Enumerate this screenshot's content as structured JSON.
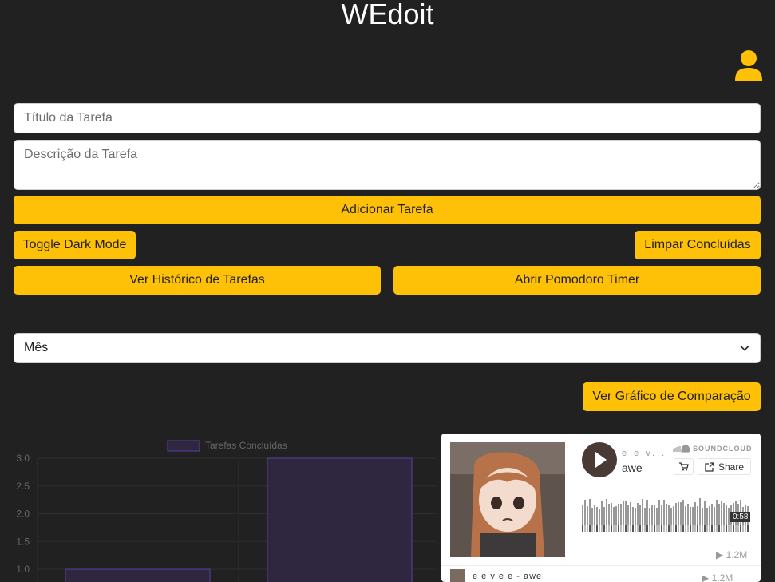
{
  "app": {
    "title": "WEdoit"
  },
  "form": {
    "title_placeholder": "Título da Tarefa",
    "description_placeholder": "Descrição da Tarefa",
    "add_label": "Adicionar Tarefa"
  },
  "controls": {
    "dark_mode_label": "Toggle Dark Mode",
    "clear_completed_label": "Limpar Concluídas",
    "history_label": "Ver Histórico de Tarefas",
    "pomodoro_label": "Abrir Pomodoro Timer"
  },
  "period_select": {
    "selected": "Mês"
  },
  "compare_label": "Ver Gráfico de Comparação",
  "colors": {
    "accent": "#ffc107",
    "background": "#212121",
    "bar_fill": "#2f2640",
    "bar_border": "#5c3fa0"
  },
  "chart_data": {
    "type": "bar",
    "legend": [
      "Tarefas Concluídas"
    ],
    "y_ticks": [
      "3.0",
      "2.5",
      "2.0",
      "1.5",
      "1.0"
    ],
    "ylim": [
      1.0,
      3.0
    ],
    "series": [
      {
        "name": "Tarefas Concluídas",
        "values": [
          1,
          3
        ]
      }
    ]
  },
  "soundcloud": {
    "user": "e e v...",
    "track": "awe",
    "brand": "SOUNDCLOUD",
    "share_label": "Share",
    "duration": "0:58",
    "plays": "1.2M",
    "list_item_text": "e e v e e - awe",
    "list_item_plays": "1.2M"
  }
}
